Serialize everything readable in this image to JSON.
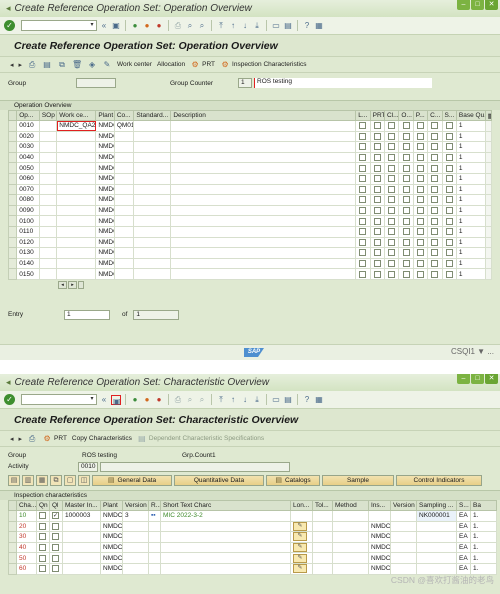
{
  "win1": {
    "title": "Create Reference Operation Set: Operation Overview",
    "page_title": "Create Reference Operation Set: Operation Overview",
    "appbar": [
      "Work center",
      "Allocation",
      "PRT",
      "Inspection Characteristics"
    ],
    "group_label": "Group",
    "group_counter_label": "Group Counter",
    "group_counter_value": "1",
    "description_value": "ROS testing",
    "section": "Operation Overview",
    "columns": [
      "Op...",
      "SOp",
      "Work ce...",
      "Plant",
      "Co...",
      "Standard...",
      "Description",
      "L...",
      "PRT",
      "Cl...",
      "O...",
      "P...",
      "C...",
      "S...",
      "Base Qu..."
    ],
    "rows": [
      {
        "op": "0010",
        "wc": "NMDC_QA2",
        "plant": "NMDC",
        "co": "QM01",
        "qty": "1"
      },
      {
        "op": "0020",
        "wc": "",
        "plant": "NMDC",
        "co": "",
        "qty": "1"
      },
      {
        "op": "0030",
        "wc": "",
        "plant": "NMDC",
        "co": "",
        "qty": "1"
      },
      {
        "op": "0040",
        "wc": "",
        "plant": "NMDC",
        "co": "",
        "qty": "1"
      },
      {
        "op": "0050",
        "wc": "",
        "plant": "NMDC",
        "co": "",
        "qty": "1"
      },
      {
        "op": "0060",
        "wc": "",
        "plant": "NMDC",
        "co": "",
        "qty": "1"
      },
      {
        "op": "0070",
        "wc": "",
        "plant": "NMDC",
        "co": "",
        "qty": "1"
      },
      {
        "op": "0080",
        "wc": "",
        "plant": "NMDC",
        "co": "",
        "qty": "1"
      },
      {
        "op": "0090",
        "wc": "",
        "plant": "NMDC",
        "co": "",
        "qty": "1"
      },
      {
        "op": "0100",
        "wc": "",
        "plant": "NMDC",
        "co": "",
        "qty": "1"
      },
      {
        "op": "0110",
        "wc": "",
        "plant": "NMDC",
        "co": "",
        "qty": "1"
      },
      {
        "op": "0120",
        "wc": "",
        "plant": "NMDC",
        "co": "",
        "qty": "1"
      },
      {
        "op": "0130",
        "wc": "",
        "plant": "NMDC",
        "co": "",
        "qty": "1"
      },
      {
        "op": "0140",
        "wc": "",
        "plant": "NMDC",
        "co": "",
        "qty": "1"
      },
      {
        "op": "0150",
        "wc": "",
        "plant": "NMDC",
        "co": "",
        "qty": "1"
      }
    ],
    "entry_label": "Entry",
    "entry_value": "1",
    "of_label": "of",
    "of_value": "1",
    "status_text": "CSQI1 ▼ ...",
    "sap_logo": "SAP"
  },
  "win2": {
    "title": "Create Reference Operation Set: Characteristic Overview",
    "page_title": "Create Reference Operation Set: Characteristic Overview",
    "appbar": [
      "PRT",
      "Copy Characteristics",
      "Dependent Characteristic Specifications"
    ],
    "group_label": "Group",
    "group_value": "ROS testing",
    "grp_count_label": "Grp.Count1",
    "activity_label": "Activity",
    "activity_value": "0010",
    "tabs": [
      "General Data",
      "Quantitative Data",
      "Catalogs",
      "Sample",
      "Control Indicators"
    ],
    "section": "Inspection characteristics",
    "columns": [
      "Cha...",
      "Qn",
      "Ql",
      "Master In...",
      "Plant",
      "Version",
      "R...",
      "Short Text Charc",
      "Lon...",
      "Tol...",
      "Method",
      "Ins...",
      "Version",
      "Sampling ...",
      "S...",
      "Ba"
    ],
    "rows": [
      {
        "cha": "10",
        "ql": true,
        "master": "1000003",
        "plant": "NMDC",
        "version": "3",
        "short": "MIC 2022-3-2",
        "ins": "",
        "sampling": "NK000001",
        "s": "EA",
        "ba": "1."
      },
      {
        "cha": "20",
        "ql": false,
        "master": "",
        "plant": "NMDC",
        "version": "",
        "short": "",
        "ins": "NMDC",
        "sampling": "",
        "s": "EA",
        "ba": "1."
      },
      {
        "cha": "30",
        "ql": false,
        "master": "",
        "plant": "NMDC",
        "version": "",
        "short": "",
        "ins": "NMDC",
        "sampling": "",
        "s": "EA",
        "ba": "1."
      },
      {
        "cha": "40",
        "ql": false,
        "master": "",
        "plant": "NMDC",
        "version": "",
        "short": "",
        "ins": "NMDC",
        "sampling": "",
        "s": "EA",
        "ba": "1."
      },
      {
        "cha": "50",
        "ql": false,
        "master": "",
        "plant": "NMDC",
        "version": "",
        "short": "",
        "ins": "NMDC",
        "sampling": "",
        "s": "EA",
        "ba": "1."
      },
      {
        "cha": "60",
        "ql": false,
        "master": "",
        "plant": "NMDC",
        "version": "",
        "short": "",
        "ins": "NMDC",
        "sampling": "",
        "s": "EA",
        "ba": "1."
      }
    ],
    "watermark": "CSDN @喜欢打酱油的老鸟"
  },
  "colors": {
    "window_bg": "#dfe9d1",
    "highlight": "#e02020",
    "accent": "#3e8e2f"
  }
}
